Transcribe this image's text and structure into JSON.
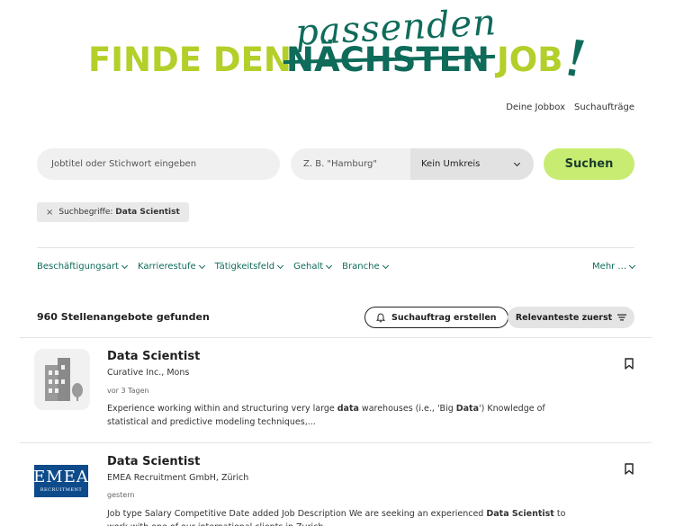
{
  "hero": {
    "word1": "FINDE DEN",
    "struck": "NÄCHSTEN",
    "script": "passenden",
    "word3": "JOB"
  },
  "top_links": [
    "Deine Jobbox",
    "Suchaufträge"
  ],
  "search": {
    "keyword_placeholder": "Jobtitel oder Stichwort eingeben",
    "location_placeholder": "Z. B. \"Hamburg\"",
    "radius_value": "Kein Umkreis",
    "button_label": "Suchen"
  },
  "chip": {
    "prefix": "Suchbegriffe:",
    "value": "Data Scientist"
  },
  "filters": [
    "Beschäftigungsart",
    "Karrierestufe",
    "Tätigkeitsfeld",
    "Gehalt",
    "Branche"
  ],
  "filters_more": "Mehr ...",
  "results": {
    "count_label": "960 Stellenangebote gefunden",
    "alert_label": "Suchauftrag erstellen",
    "sort_label": "Relevanteste zuerst"
  },
  "jobs": [
    {
      "title": "Data Scientist",
      "company": "Curative Inc., Mons",
      "date": "vor 3 Tagen",
      "desc_parts": [
        "Experience working within and structuring very large ",
        "data",
        " warehouses (i.e., 'Big ",
        "Data",
        "') Knowledge of statistical and predictive modeling techniques,..."
      ]
    },
    {
      "title": "Data Scientist",
      "company": "EMEA Recruitment GmbH, Zürich",
      "date": "gestern",
      "logo_text": "EMEA",
      "logo_sub": "RECRUITMENT",
      "desc_parts": [
        "Job type Salary Competitive Date added Job Description We are seeking an experienced ",
        "Data Scientist",
        " to work with one of our international clients in Zurich..."
      ]
    }
  ],
  "colors": {
    "lime": "#b3cf2a",
    "green": "#0f6b5a",
    "button": "#c8ec72"
  }
}
